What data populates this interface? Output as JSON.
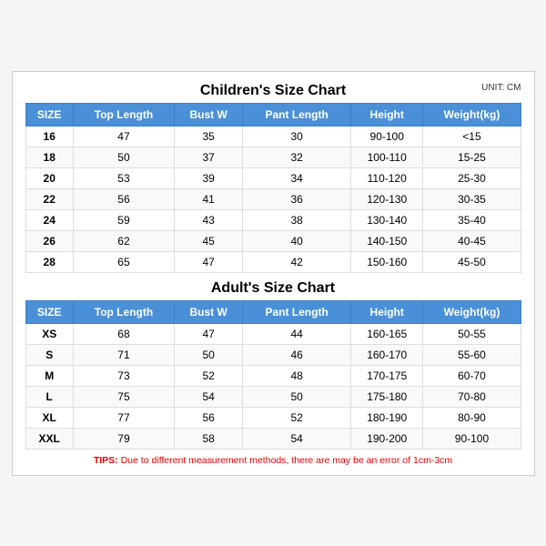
{
  "children_title": "Children's Size Chart",
  "adult_title": "Adult's Size Chart",
  "unit_label": "UNIT: CM",
  "children_headers": [
    "SIZE",
    "Top Length",
    "Bust W",
    "Pant Length",
    "Height",
    "Weight(kg)"
  ],
  "children_rows": [
    [
      "16",
      "47",
      "35",
      "30",
      "90-100",
      "<15"
    ],
    [
      "18",
      "50",
      "37",
      "32",
      "100-110",
      "15-25"
    ],
    [
      "20",
      "53",
      "39",
      "34",
      "110-120",
      "25-30"
    ],
    [
      "22",
      "56",
      "41",
      "36",
      "120-130",
      "30-35"
    ],
    [
      "24",
      "59",
      "43",
      "38",
      "130-140",
      "35-40"
    ],
    [
      "26",
      "62",
      "45",
      "40",
      "140-150",
      "40-45"
    ],
    [
      "28",
      "65",
      "47",
      "42",
      "150-160",
      "45-50"
    ]
  ],
  "adult_headers": [
    "SIZE",
    "Top Length",
    "Bust W",
    "Pant Length",
    "Height",
    "Weight(kg)"
  ],
  "adult_rows": [
    [
      "XS",
      "68",
      "47",
      "44",
      "160-165",
      "50-55"
    ],
    [
      "S",
      "71",
      "50",
      "46",
      "160-170",
      "55-60"
    ],
    [
      "M",
      "73",
      "52",
      "48",
      "170-175",
      "60-70"
    ],
    [
      "L",
      "75",
      "54",
      "50",
      "175-180",
      "70-80"
    ],
    [
      "XL",
      "77",
      "56",
      "52",
      "180-190",
      "80-90"
    ],
    [
      "XXL",
      "79",
      "58",
      "54",
      "190-200",
      "90-100"
    ]
  ],
  "tips": {
    "label": "TIPS:",
    "text": " Due to different measurement methods, there are may be an error of 1cm-3cm"
  }
}
